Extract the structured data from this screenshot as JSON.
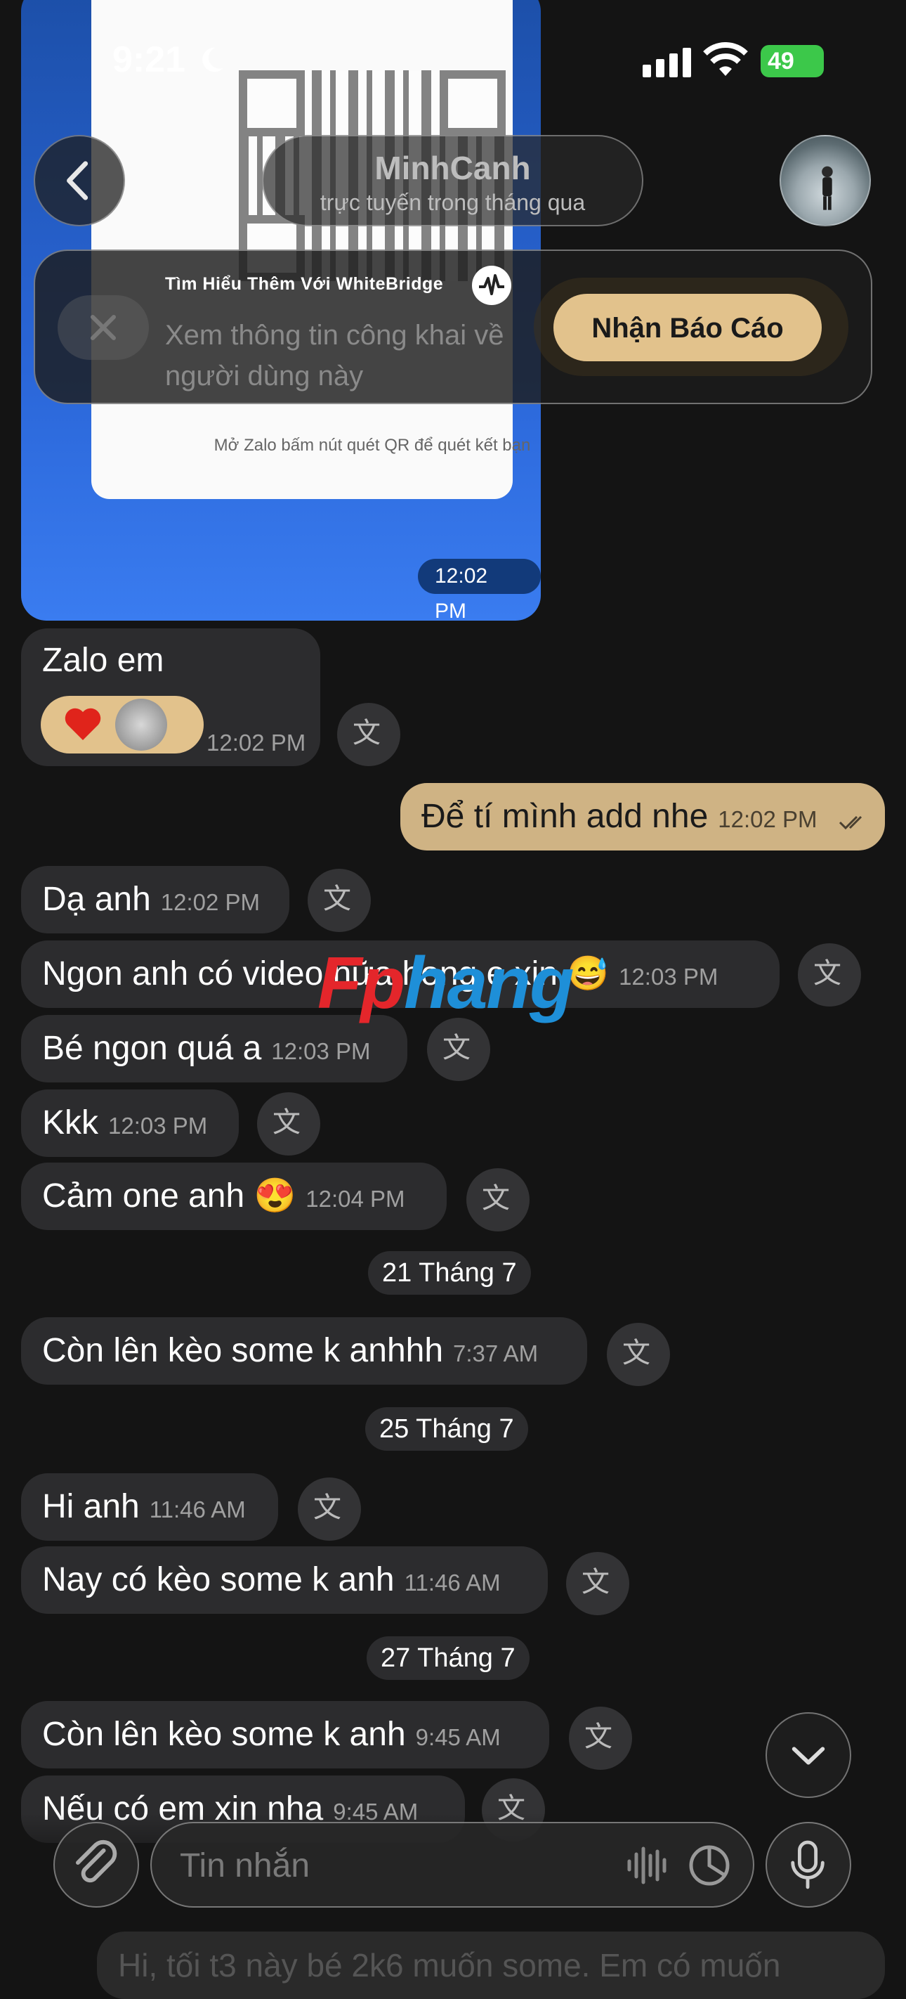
{
  "status_bar": {
    "time": "9:21",
    "battery": "49"
  },
  "header": {
    "contact_name": "MinhCanh",
    "contact_status": "trực tuyến trong tháng qua"
  },
  "shared_card": {
    "hint": "Mở Zalo bấm nút quét QR  để quét kết bạn",
    "time": "12:02 PM"
  },
  "banner": {
    "heading": "Tìm Hiểu Thêm Với WhiteBridge",
    "description": "Xem thông tin công khai về người dùng này",
    "cta": "Nhận Báo Cáo"
  },
  "messages": [
    {
      "text": "Zalo em",
      "time": "12:02 PM"
    },
    {
      "text": "Để tí mình add nhe",
      "time": "12:02 PM"
    },
    {
      "text": "Dạ anh",
      "time": "12:02 PM"
    },
    {
      "text": "Ngon anh có video nữa hong e xin 😅",
      "time": "12:03 PM"
    },
    {
      "text": "Bé ngon quá a",
      "time": "12:03 PM"
    },
    {
      "text": "Kkk",
      "time": "12:03 PM"
    },
    {
      "text": "Cảm one anh 😍",
      "time": "12:04 PM"
    },
    {
      "text": "Còn lên kèo some k anhhh",
      "time": "7:37 AM"
    },
    {
      "text": "Hi anh",
      "time": "11:46 AM"
    },
    {
      "text": "Nay có kèo some k anh",
      "time": "11:46 AM"
    },
    {
      "text": "Còn lên kèo some k anh",
      "time": "9:45 AM"
    },
    {
      "text": "Nếu có em xin nha",
      "time": "9:45 AM"
    }
  ],
  "dates": [
    "21 Tháng 7",
    "25 Tháng 7",
    "27 Tháng 7"
  ],
  "composer": {
    "placeholder": "Tin nhắn"
  },
  "ghost_message": "Hi, tối t3 này bé 2k6 muốn some. Em có muốn",
  "watermark": {
    "part1": "Fp",
    "part2": "hang"
  }
}
